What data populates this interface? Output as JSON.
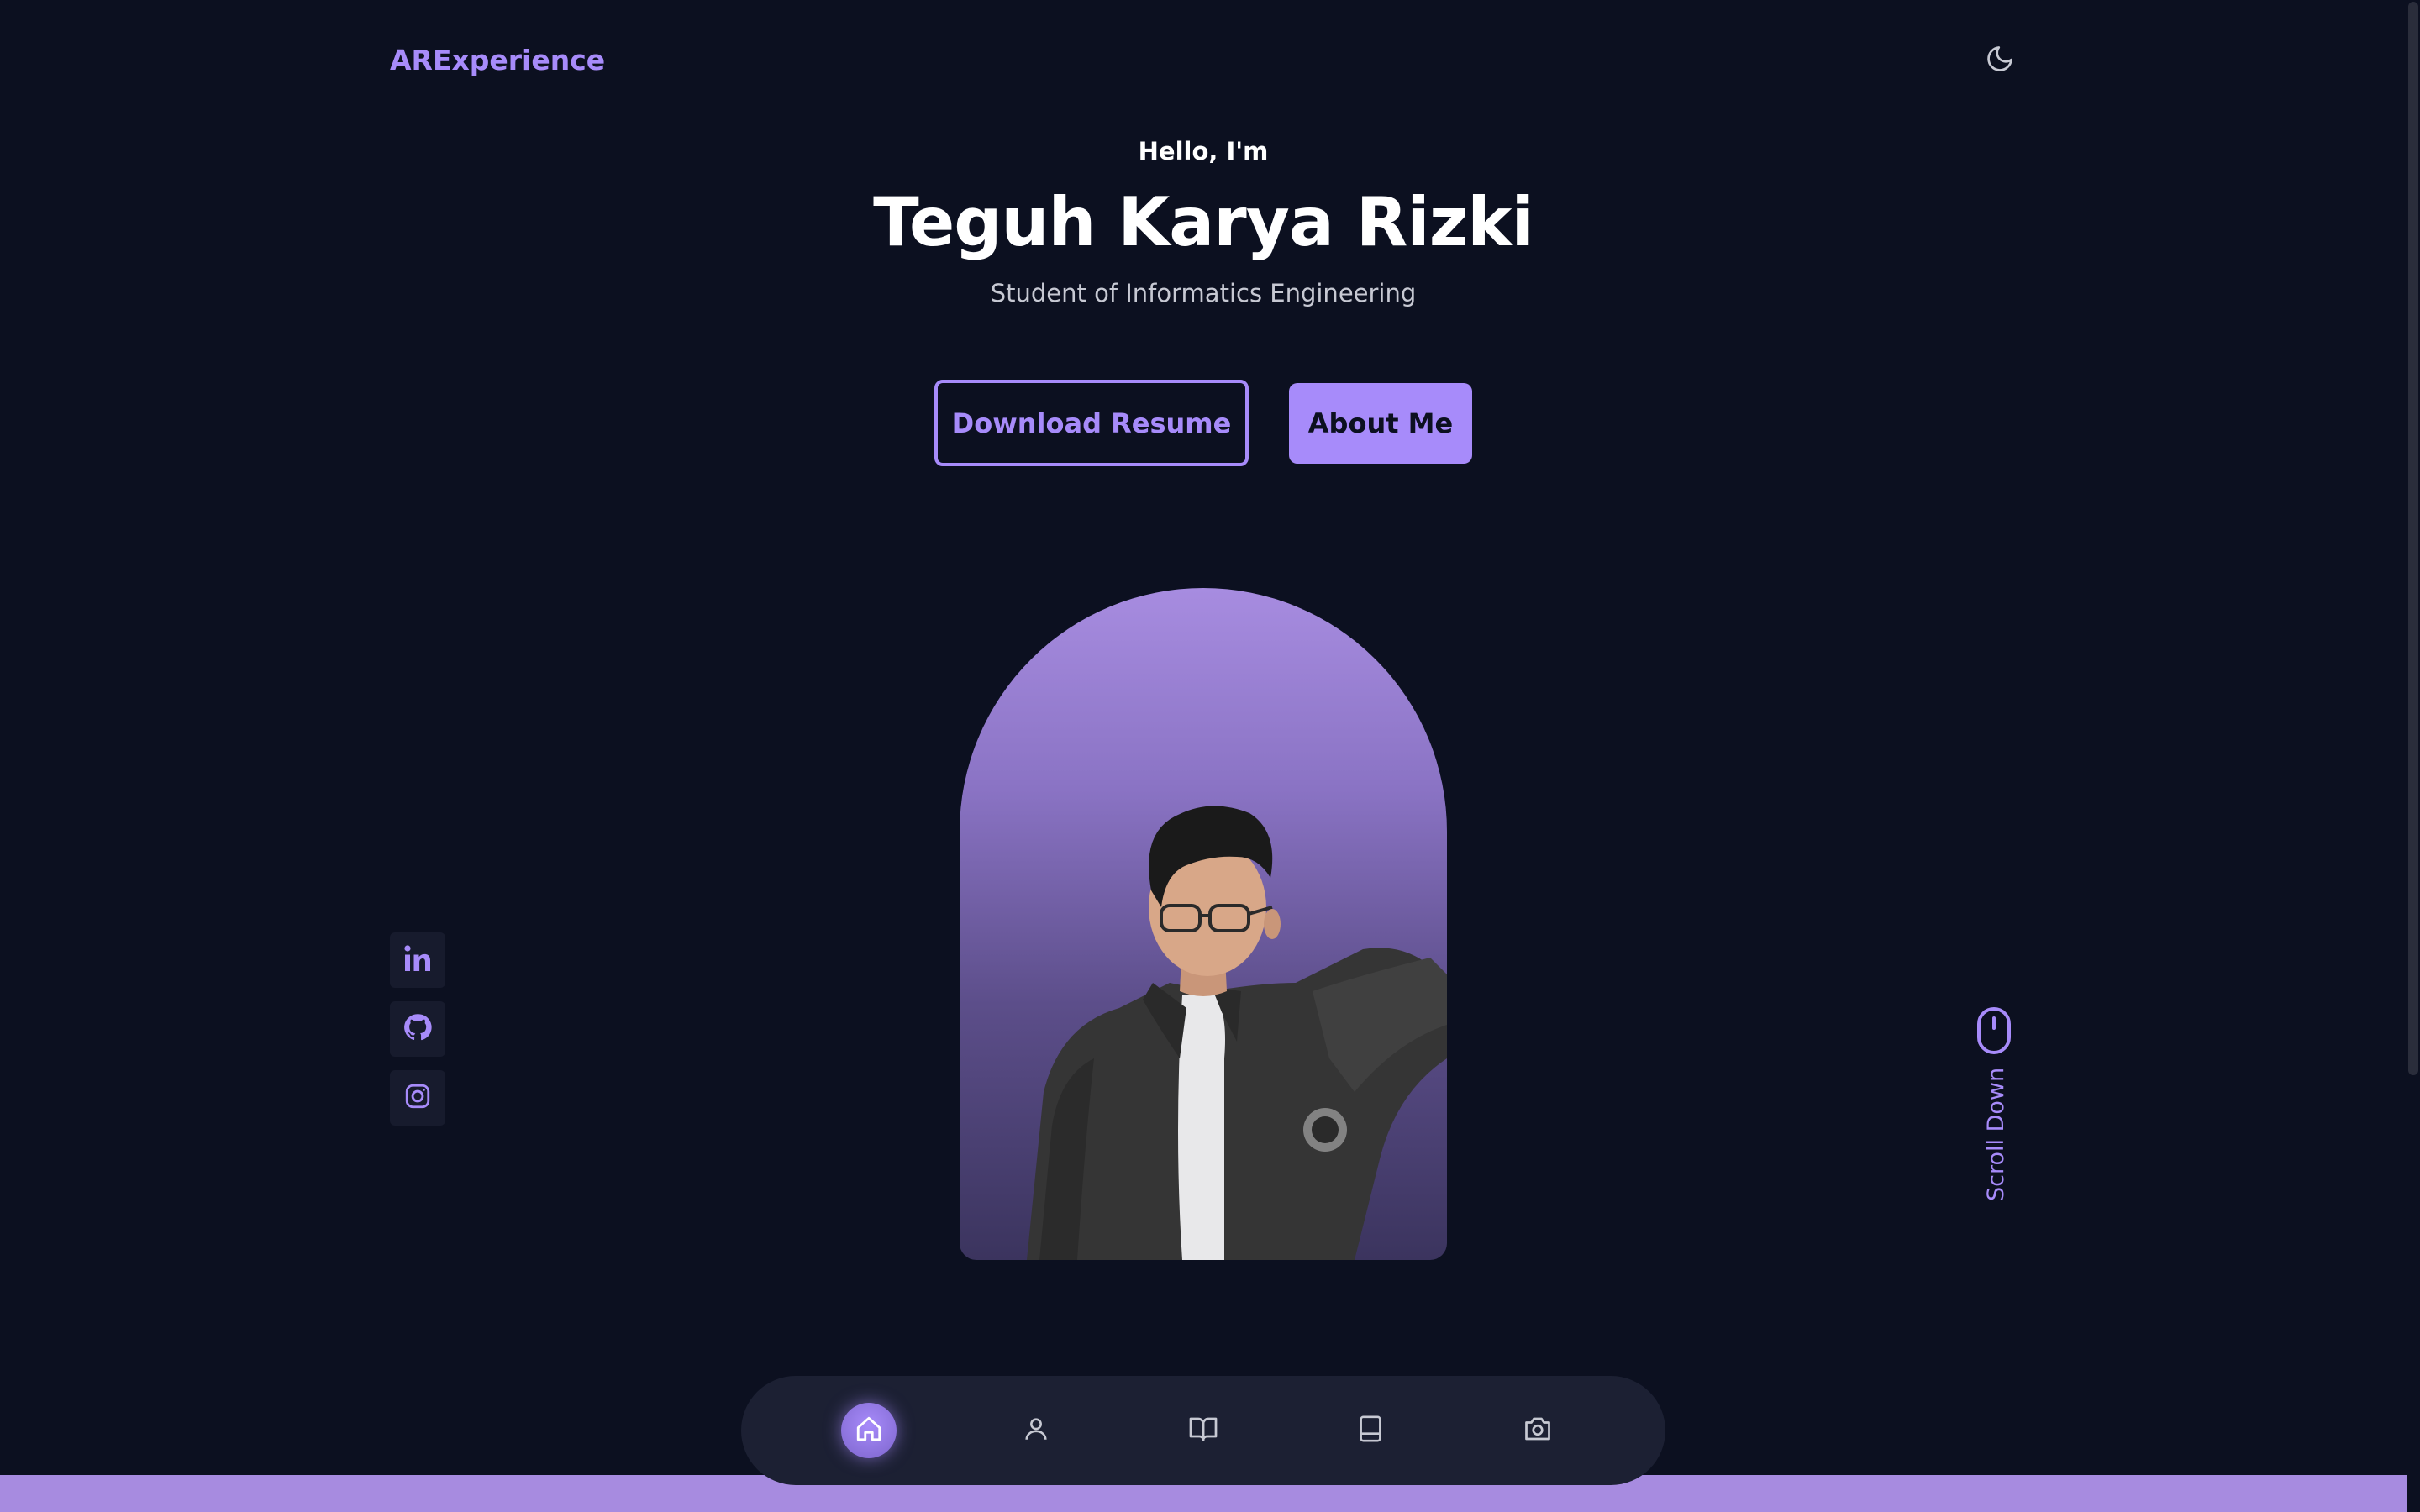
{
  "header": {
    "logo": "ARExperience",
    "theme_toggle_icon": "moon-icon"
  },
  "hero": {
    "greeting": "Hello, I'm",
    "name": "Teguh Karya Rizki",
    "subtitle": "Student of Informatics Engineering",
    "download_resume_label": "Download Resume",
    "about_me_label": "About Me"
  },
  "socials": [
    {
      "icon": "linkedin-icon"
    },
    {
      "icon": "github-icon"
    },
    {
      "icon": "instagram-icon"
    }
  ],
  "scroll": {
    "label": "Scroll Down",
    "icon": "mouse-icon"
  },
  "nav": {
    "items": [
      {
        "icon": "home-icon",
        "active": true
      },
      {
        "icon": "user-icon",
        "active": false
      },
      {
        "icon": "book-open-icon",
        "active": false
      },
      {
        "icon": "notebook-icon",
        "active": false
      },
      {
        "icon": "camera-icon",
        "active": false
      }
    ]
  },
  "colors": {
    "background": "#0c1020",
    "accent": "#a78bfa",
    "nav_background": "#1c2033"
  }
}
